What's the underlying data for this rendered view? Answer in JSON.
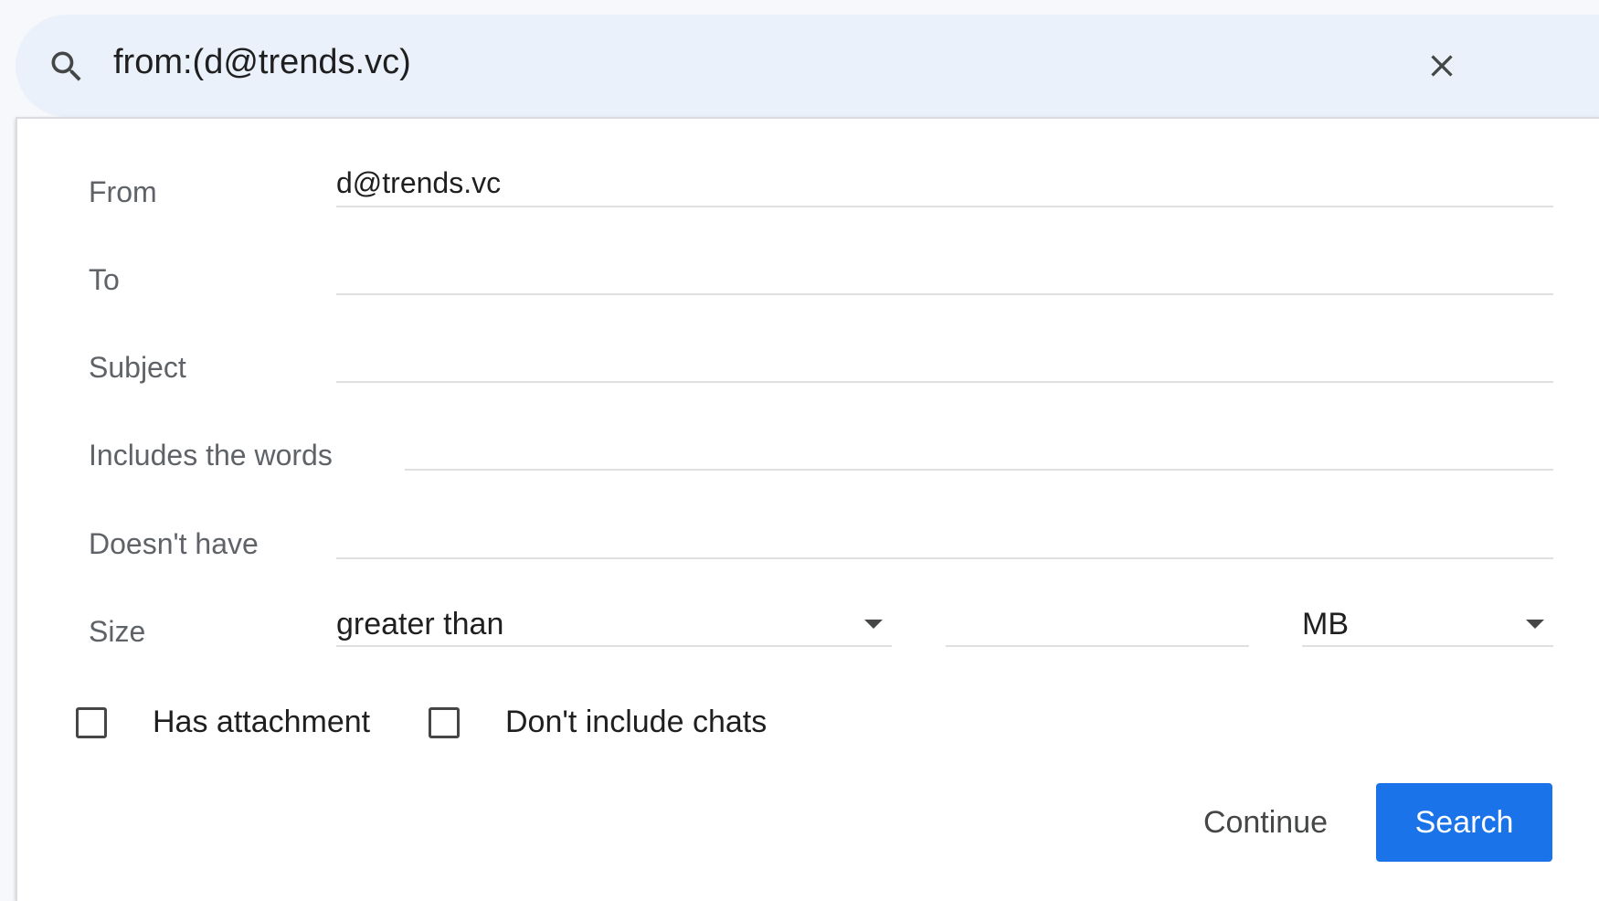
{
  "search": {
    "query": "from:(d@trends.vc)"
  },
  "form": {
    "from": {
      "label": "From",
      "value": "d@trends.vc"
    },
    "to": {
      "label": "To",
      "value": ""
    },
    "subject": {
      "label": "Subject",
      "value": ""
    },
    "includes": {
      "label": "Includes the words",
      "value": ""
    },
    "doesnt_have": {
      "label": "Doesn't have",
      "value": ""
    },
    "size": {
      "label": "Size",
      "comparator": "greater than",
      "amount": "",
      "unit": "MB"
    },
    "has_attachment": {
      "label": "Has attachment",
      "checked": false
    },
    "dont_include_chats": {
      "label": "Don't include chats",
      "checked": false
    }
  },
  "actions": {
    "continue_label": "Continue",
    "search_label": "Search"
  },
  "colors": {
    "accent": "#1a73e8",
    "searchbar_bg": "#eaf1fb",
    "label_text": "#5f6368"
  },
  "icons": {
    "search": "search-icon",
    "close": "close-icon",
    "dropdown": "chevron-down-icon"
  }
}
